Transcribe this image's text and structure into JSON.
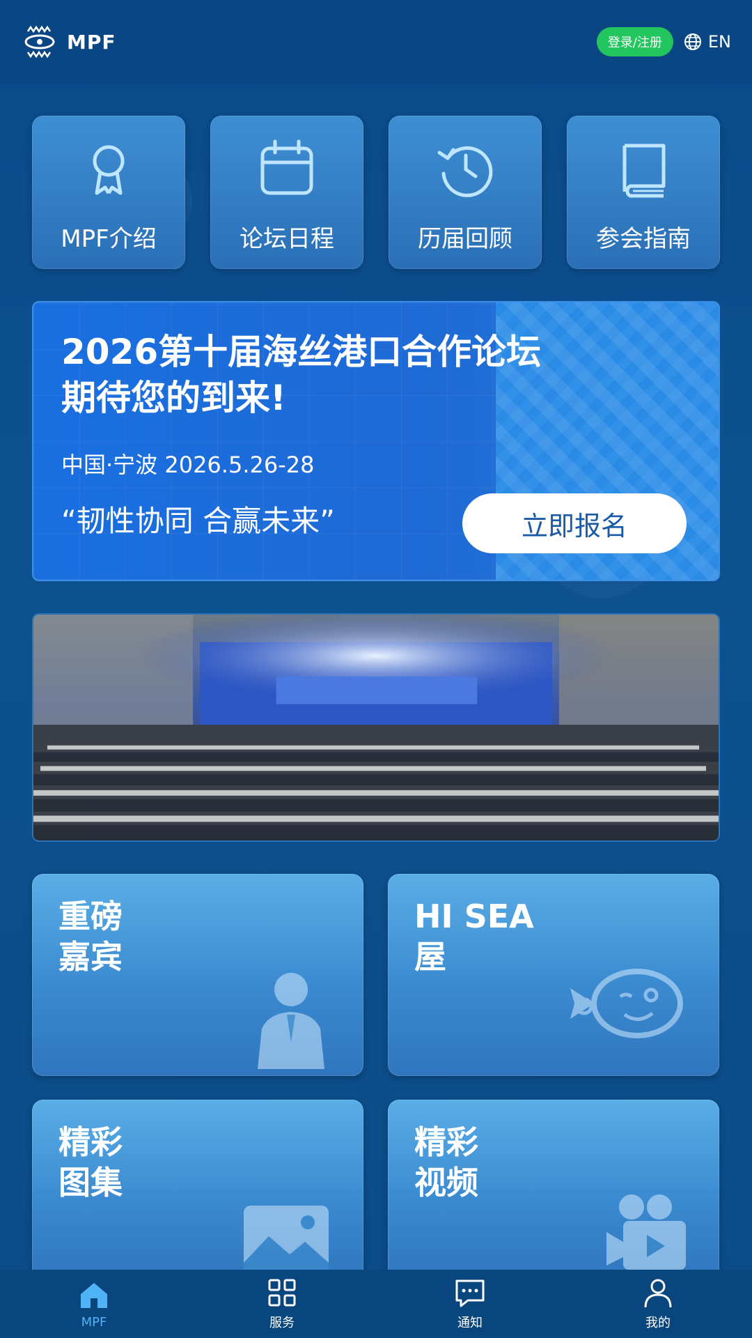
{
  "header": {
    "logo_text": "MPF",
    "login_label": "登录/注册",
    "language_label": "EN"
  },
  "quick_links": [
    {
      "label": "MPF介绍",
      "icon": "award-ribbon-icon"
    },
    {
      "label": "论坛日程",
      "icon": "calendar-icon"
    },
    {
      "label": "历届回顾",
      "icon": "history-clock-icon"
    },
    {
      "label": "参会指南",
      "icon": "book-icon"
    }
  ],
  "banner": {
    "title_line1": "2026第十届海丝港口合作论坛",
    "title_line2": "期待您的到来!",
    "location_date": "中国·宁波 2026.5.26-28",
    "slogan": "“韧性协同 合赢未来”",
    "register_label": "立即报名"
  },
  "feature_cards": [
    {
      "title": "重磅\n嘉宾",
      "icon": "speaker-person-icon"
    },
    {
      "title": "HI SEA\n屋",
      "icon": "fish-mascot-icon"
    },
    {
      "title": "精彩\n图集",
      "icon": "image-gallery-icon"
    },
    {
      "title": "精彩\n视频",
      "icon": "video-camera-icon"
    }
  ],
  "bottom_nav": [
    {
      "label": "MPF",
      "icon": "home-icon",
      "active": true
    },
    {
      "label": "服务",
      "icon": "grid-icon",
      "active": false
    },
    {
      "label": "通知",
      "icon": "message-icon",
      "active": false
    },
    {
      "label": "我的",
      "icon": "user-icon",
      "active": false
    }
  ],
  "colors": {
    "background": "#0c4c8c",
    "login_green": "#22c55e",
    "active_nav": "#4fb3f6",
    "banner_blue": "#1a6fe0"
  }
}
